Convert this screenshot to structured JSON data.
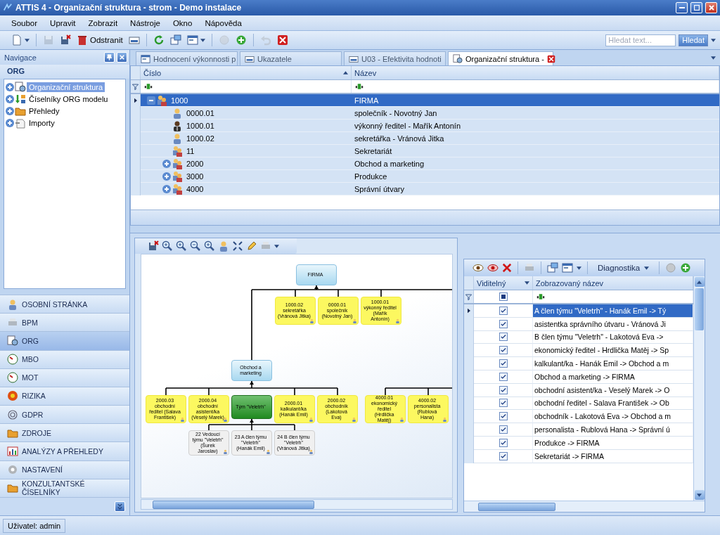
{
  "window": {
    "title": "ATTIS 4 - Organizační struktura - strom - Demo instalace"
  },
  "menu": [
    "Soubor",
    "Upravit",
    "Zobrazit",
    "Nástroje",
    "Okno",
    "Nápověda"
  ],
  "toolbar": {
    "buttons": [
      {
        "disabled": false
      },
      {
        "disabled": true
      },
      {
        "disabled": false
      },
      {
        "label": "Odstranit",
        "disabled": false
      },
      {
        "disabled": false
      },
      {
        "disabled": false
      },
      {
        "disabled": false
      },
      {
        "disabled": false
      },
      {
        "disabled": true
      },
      {
        "disabled": false
      },
      {
        "disabled": true
      },
      {
        "disabled": false
      }
    ],
    "search": {
      "placeholder": "Hledat text...",
      "button": "Hledat"
    }
  },
  "navigation": {
    "title": "Navigace",
    "section": "ORG",
    "tree": [
      {
        "label": "Organizační struktura",
        "selected": true,
        "expanded": false
      },
      {
        "label": "Číselníky ORG modelu",
        "selected": false,
        "expanded": false
      },
      {
        "label": "Přehledy",
        "selected": false,
        "expanded": false
      },
      {
        "label": "Importy",
        "selected": false,
        "expanded": false
      }
    ],
    "modules": [
      {
        "label": "OSOBNÍ STRÁNKA",
        "selected": false
      },
      {
        "label": "BPM",
        "selected": false
      },
      {
        "label": "ORG",
        "selected": true
      },
      {
        "label": "MBO",
        "selected": false
      },
      {
        "label": "MOT",
        "selected": false
      },
      {
        "label": "RIZIKA",
        "selected": false
      },
      {
        "label": "GDPR",
        "selected": false
      },
      {
        "label": "ZDROJE",
        "selected": false
      },
      {
        "label": "ANALÝZY A PŘEHLEDY",
        "selected": false
      },
      {
        "label": "NASTAVENÍ",
        "selected": false
      },
      {
        "label": "KONZULTANTSKÉ ČÍSELNÍKY",
        "selected": false
      }
    ]
  },
  "tabs": [
    {
      "label": "Hodnocení výkonnosti p",
      "selected": false
    },
    {
      "label": "Ukazatele",
      "selected": false
    },
    {
      "label": "U03 - Efektivita hodnoti",
      "selected": false
    },
    {
      "label": "Organizační struktura -",
      "selected": true
    }
  ],
  "org_grid": {
    "columns": [
      {
        "label": "Číslo",
        "sorted": true
      },
      {
        "label": "Název",
        "sorted": false
      }
    ],
    "rows": [
      {
        "number": "1000",
        "name": "FIRMA",
        "kind": "unit",
        "selected": true,
        "expanded": true,
        "children": [
          {
            "number": "0000.01",
            "name": "společník - Novotný Jan",
            "kind": "person",
            "selected": false
          },
          {
            "number": "1000.01",
            "name": "výkonný ředitel - Mařík Antonín",
            "kind": "manager",
            "selected": false
          },
          {
            "number": "1000.02",
            "name": "sekretářka - Vránová Jitka",
            "kind": "person",
            "selected": false
          },
          {
            "number": "11",
            "name": "Sekretariát",
            "kind": "unit",
            "selected": false
          },
          {
            "number": "2000",
            "name": "Obchod a marketing",
            "kind": "unit",
            "selected": false,
            "expanded": false
          },
          {
            "number": "3000",
            "name": "Produkce",
            "kind": "unit",
            "selected": false,
            "expanded": false
          },
          {
            "number": "4000",
            "name": "Správní útvary",
            "kind": "unit",
            "selected": false,
            "expanded": false
          }
        ]
      }
    ]
  },
  "diagram": {
    "nodes": [
      {
        "kind": "unit",
        "text": "FIRMA"
      },
      {
        "kind": "position",
        "text": "1000.02 sekretářka (Vránová Jitka)"
      },
      {
        "kind": "position",
        "text": "0000.01 společník (Novotný Jan)"
      },
      {
        "kind": "position",
        "text": "1000.01 výkonný ředitel (Mařík Antonín)"
      },
      {
        "kind": "unit",
        "text": "Obchod a marketing"
      },
      {
        "kind": "position",
        "text": "2000.03 obchodní ředitel (Salava František)"
      },
      {
        "kind": "position",
        "text": "2000.04 obchodní asistent/ka (Veselý Marek)"
      },
      {
        "kind": "team",
        "text": "Tým \"Veletrh\""
      },
      {
        "kind": "position",
        "text": "2000.01 kalkulant/ka (Hanák Emil)"
      },
      {
        "kind": "position",
        "text": "2000.02 obchodník (Lakotová Eva)"
      },
      {
        "kind": "position",
        "text": "4000.01 ekonomický ředitel (Hrdlička Matěj)"
      },
      {
        "kind": "position",
        "text": "4000.02 personalista (Rublová Hana)"
      },
      {
        "kind": "member",
        "text": "22 Vedoucí týmu \"Veletrh\" (Šurek Jaroslav)"
      },
      {
        "kind": "member",
        "text": "23 A člen týmu \"Veletrh\" (Hanák Emil)"
      },
      {
        "kind": "member",
        "text": "24 B člen týmu \"Veletrh\" (Vránová Jitka)"
      }
    ]
  },
  "visibility_panel": {
    "menu": "Diagnostika",
    "columns": [
      "Viditelný",
      "Zobrazovaný název"
    ],
    "filter": {
      "indeterminate": true
    },
    "rows": [
      {
        "visible": true,
        "name": "A člen týmu \"Veletrh\" - Hanák Emil -> Tý",
        "selected": true
      },
      {
        "visible": true,
        "name": "asistentka správního útvaru - Vránová Ji",
        "selected": false
      },
      {
        "visible": true,
        "name": "B člen týmu \"Veletrh\" - Lakotová Eva ->",
        "selected": false
      },
      {
        "visible": true,
        "name": "ekonomický ředitel - Hrdlička Matěj -> Sp",
        "selected": false
      },
      {
        "visible": true,
        "name": "kalkulant/ka - Hanák Emil -> Obchod a m",
        "selected": false
      },
      {
        "visible": true,
        "name": "Obchod a marketing -> FIRMA",
        "selected": false
      },
      {
        "visible": true,
        "name": "obchodní asistent/ka - Veselý Marek -> O",
        "selected": false
      },
      {
        "visible": true,
        "name": "obchodní ředitel - Salava František -> Ob",
        "selected": false
      },
      {
        "visible": true,
        "name": "obchodník - Lakotová Eva -> Obchod a m",
        "selected": false
      },
      {
        "visible": true,
        "name": "personalista - Rublová Hana -> Správní ú",
        "selected": false
      },
      {
        "visible": true,
        "name": "Produkce -> FIRMA",
        "selected": false
      },
      {
        "visible": true,
        "name": "Sekretariát -> FIRMA",
        "selected": false
      }
    ]
  },
  "status_bar": "Uživatel: admin"
}
